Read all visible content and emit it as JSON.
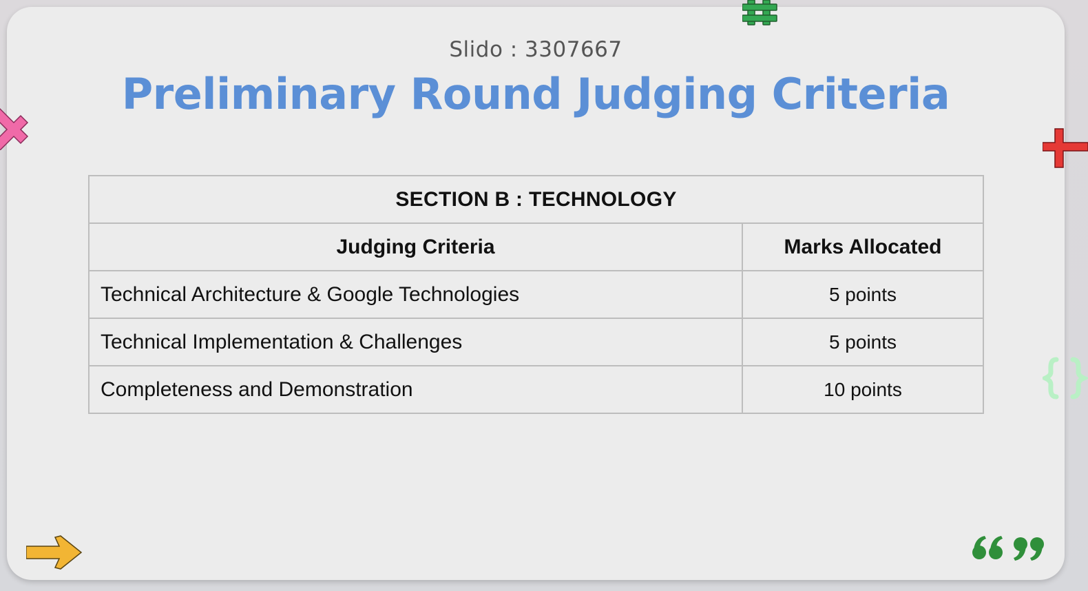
{
  "slide": {
    "subtitle": "Slido : 3307667",
    "title": "Preliminary Round Judging Criteria"
  },
  "table": {
    "section_title": "SECTION B : TECHNOLOGY",
    "headers": {
      "criteria": "Judging Criteria",
      "marks": "Marks Allocated"
    },
    "rows": [
      {
        "criteria": "Technical Architecture & Google Technologies",
        "marks": "5 points"
      },
      {
        "criteria": "Technical Implementation & Challenges",
        "marks": "5 points"
      },
      {
        "criteria": "Completeness and Demonstration",
        "marks": "10 points"
      }
    ]
  },
  "decorations": {
    "hash_color": "#34a853",
    "x_color": "#f06aa8",
    "plus_color": "#e53935",
    "braces_color": "#b9f0c5",
    "arrow_color": "#f2b534",
    "quotes_color": "#2f8f3a"
  }
}
